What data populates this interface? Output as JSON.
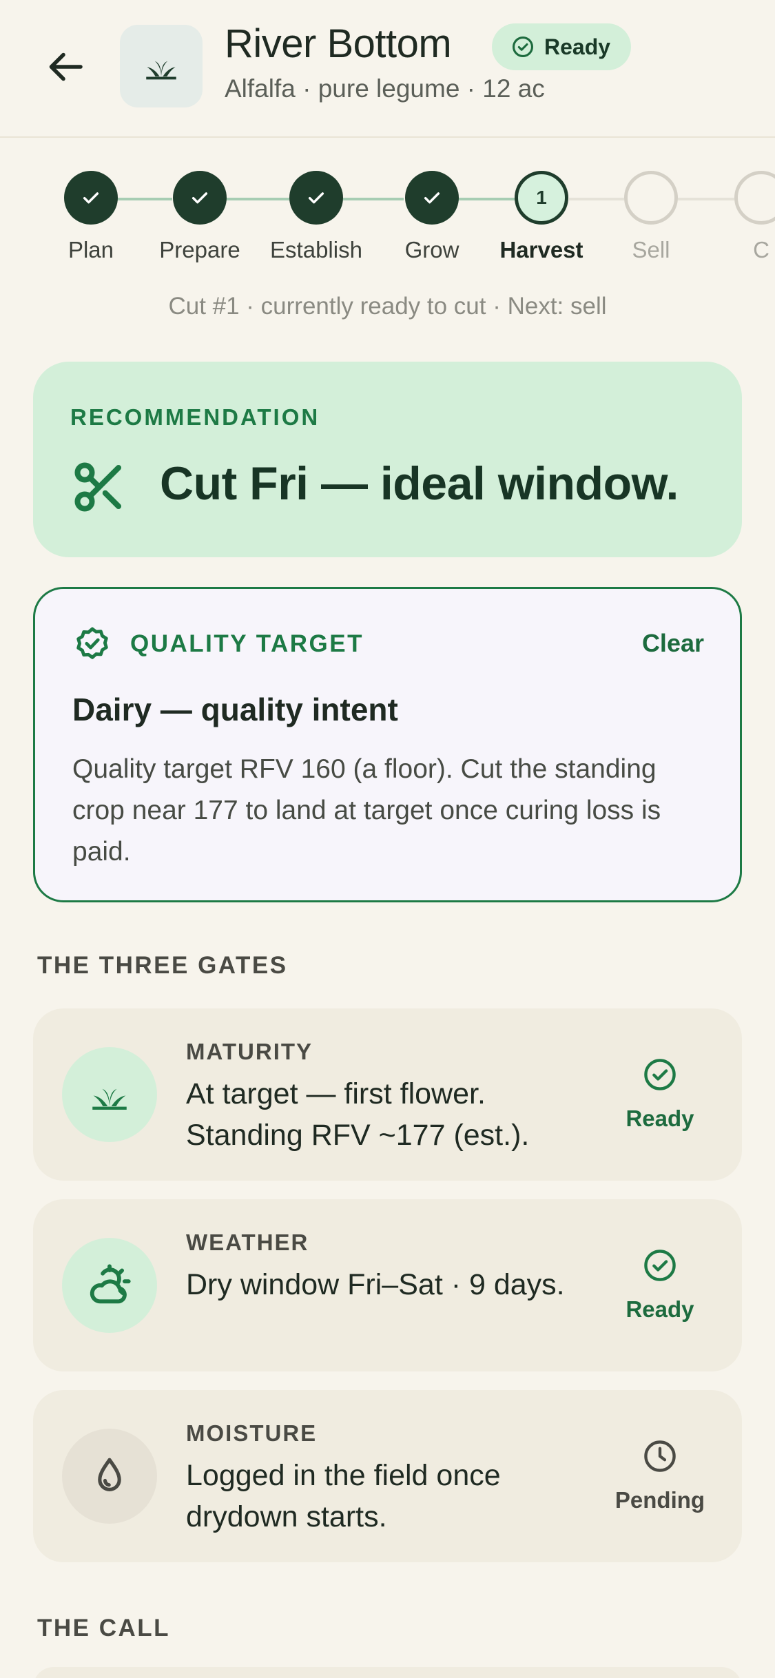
{
  "header": {
    "title": "River Bottom",
    "status_badge": "Ready",
    "subtitle": "Alfalfa · pure legume · 12 ac",
    "back_icon": "arrow-left-icon",
    "field_icon": "sprout-icon"
  },
  "stepper": {
    "steps": [
      {
        "label": "Plan",
        "state": "done"
      },
      {
        "label": "Prepare",
        "state": "done"
      },
      {
        "label": "Establish",
        "state": "done"
      },
      {
        "label": "Grow",
        "state": "done"
      },
      {
        "label": "Harvest",
        "state": "current",
        "number": "1"
      },
      {
        "label": "Sell",
        "state": "future"
      },
      {
        "label": "C",
        "state": "future"
      }
    ],
    "caption": "Cut #1 · currently ready to cut · Next: sell"
  },
  "recommendation": {
    "eyebrow": "RECOMMENDATION",
    "headline": "Cut Fri — ideal window.",
    "icon": "scissors-icon"
  },
  "quality_target": {
    "eyebrow": "QUALITY TARGET",
    "clear_label": "Clear",
    "heading": "Dairy — quality intent",
    "body": "Quality target RFV 160 (a floor). Cut the standing crop near 177 to land at target once curing loss is paid.",
    "icon": "badge-check-icon"
  },
  "gates": {
    "section_label": "THE THREE GATES",
    "items": [
      {
        "name": "MATURITY",
        "description": "At target — first flower. Standing RFV ~177 (est.).",
        "status": "Ready",
        "icon": "sprout-icon"
      },
      {
        "name": "WEATHER",
        "description": "Dry window Fri–Sat · 9 days.",
        "status": "Ready",
        "icon": "cloud-sun-icon"
      },
      {
        "name": "MOISTURE",
        "description": "Logged in the field once drydown starts.",
        "status": "Pending",
        "icon": "droplet-icon"
      }
    ]
  },
  "the_call": {
    "section_label": "THE CALL"
  },
  "colors": {
    "accent_green": "#1d7a45",
    "dark_green": "#1f3d2c",
    "mint": "#d3efd9",
    "background": "#f7f4ec"
  }
}
